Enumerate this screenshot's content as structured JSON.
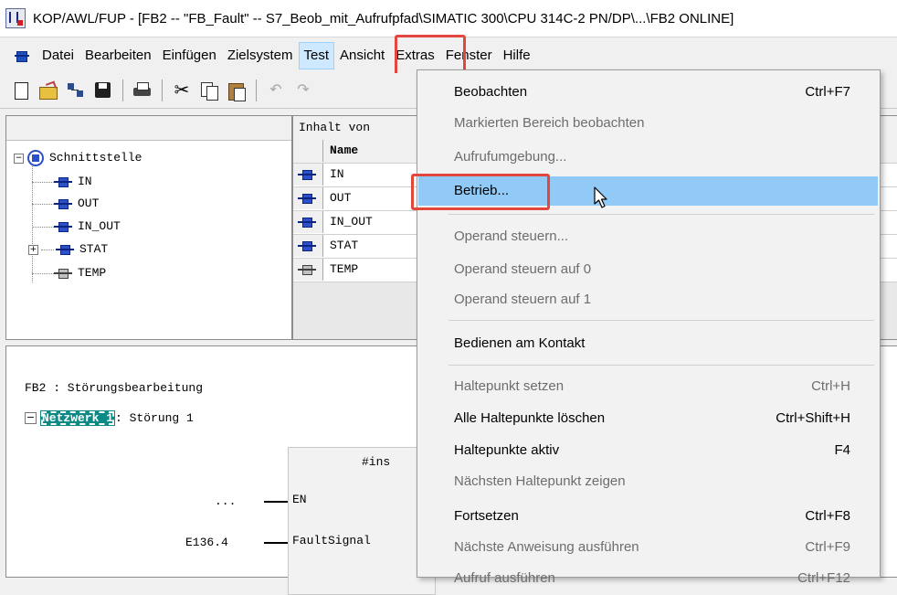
{
  "window": {
    "title": "KOP/AWL/FUP  - [FB2 -- \"FB_Fault\" -- S7_Beob_mit_Aufrufpfad\\SIMATIC 300\\CPU 314C-2 PN/DP\\...\\FB2  ONLINE]"
  },
  "menubar": {
    "items": [
      "Datei",
      "Bearbeiten",
      "Einfügen",
      "Zielsystem",
      "Test",
      "Ansicht",
      "Extras",
      "Fenster",
      "Hilfe"
    ],
    "active": "Test"
  },
  "toolbar": {
    "icons": [
      "new-icon",
      "open-icon",
      "network-icon",
      "save-icon",
      "print-icon",
      "cut-icon",
      "copy-icon",
      "paste-icon",
      "undo-icon",
      "redo-icon"
    ]
  },
  "tree": {
    "root": "Schnittstelle",
    "items": [
      "IN",
      "OUT",
      "IN_OUT",
      "STAT",
      "TEMP"
    ]
  },
  "content": {
    "header": "Inhalt von",
    "column_name": "Name",
    "rows": [
      "IN",
      "OUT",
      "IN_OUT",
      "STAT",
      "TEMP"
    ]
  },
  "editor": {
    "block_title": "FB2 : Störungsbearbeitung",
    "network_label": "Netzwerk 1",
    "network_title": ": Störung 1",
    "instance_label": "#ins",
    "en_input": "...",
    "en_pin": "EN",
    "fault_input": "E136.4",
    "fault_pin": "FaultSignal"
  },
  "test_menu": {
    "items": [
      {
        "label": "Beobachten",
        "shortcut": "Ctrl+F7",
        "enabled": true
      },
      {
        "label": "Markierten Bereich beobachten",
        "shortcut": "",
        "enabled": false
      },
      {
        "label": "Aufrufumgebung...",
        "shortcut": "",
        "enabled": false
      },
      {
        "label": "Betrieb...",
        "shortcut": "",
        "enabled": true,
        "hover": true
      },
      {
        "separator": true
      },
      {
        "label": "Operand steuern...",
        "shortcut": "",
        "enabled": false
      },
      {
        "label": "Operand steuern auf 0",
        "shortcut": "",
        "enabled": false
      },
      {
        "label": "Operand steuern auf 1",
        "shortcut": "",
        "enabled": false
      },
      {
        "separator": true
      },
      {
        "label": "Bedienen am Kontakt",
        "shortcut": "",
        "enabled": true
      },
      {
        "separator": true
      },
      {
        "label": "Haltepunkt setzen",
        "shortcut": "Ctrl+H",
        "enabled": false
      },
      {
        "label": "Alle Haltepunkte löschen",
        "shortcut": "Ctrl+Shift+H",
        "enabled": true
      },
      {
        "label": "Haltepunkte aktiv",
        "shortcut": "F4",
        "enabled": true
      },
      {
        "label": "Nächsten Haltepunkt zeigen",
        "shortcut": "",
        "enabled": false
      },
      {
        "label": "Fortsetzen",
        "shortcut": "Ctrl+F8",
        "enabled": true
      },
      {
        "label": "Nächste Anweisung ausführen",
        "shortcut": "Ctrl+F9",
        "enabled": false
      },
      {
        "label": "Aufruf ausführen",
        "shortcut": "Ctrl+F12",
        "enabled": false
      }
    ]
  },
  "colors": {
    "highlight_box": "#e2463c",
    "menu_hover": "#91c9f7",
    "network_label_bg": "#0b8a86",
    "disabled_text": "#6d6d6d"
  }
}
